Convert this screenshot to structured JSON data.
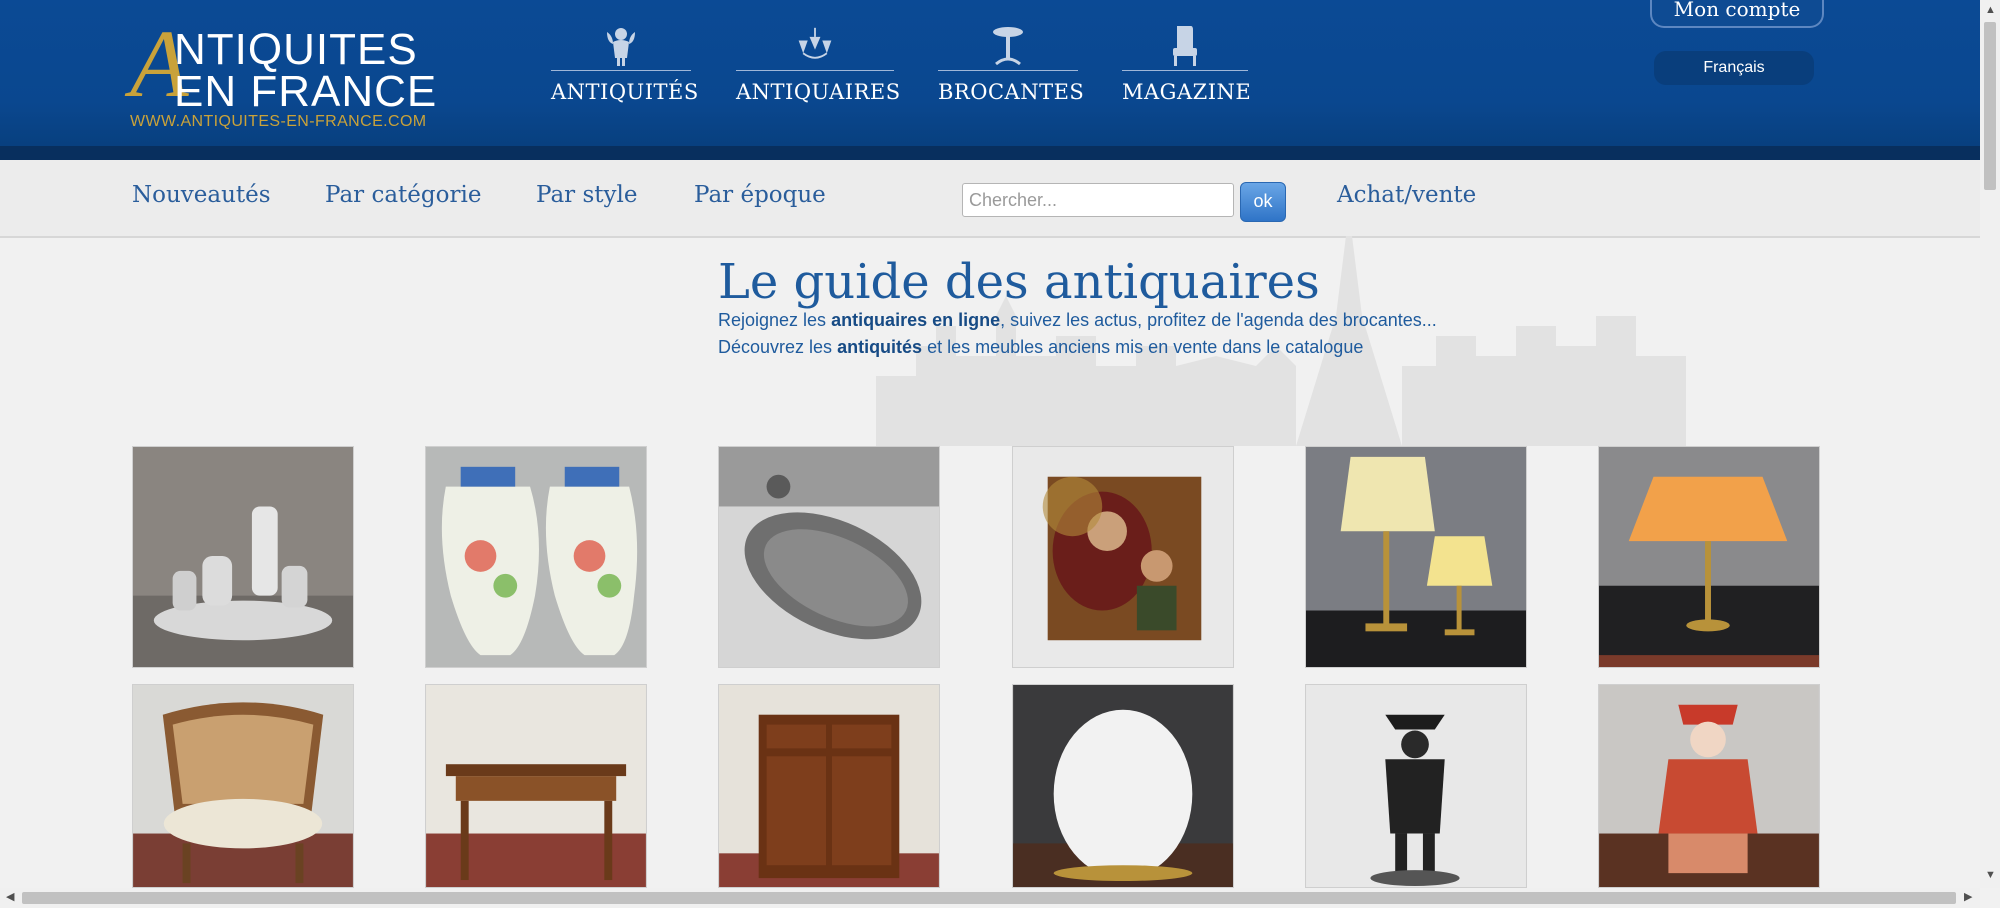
{
  "header": {
    "logo": {
      "big_letter": "A",
      "line1": "NTIQUITES",
      "line2": "EN FRANCE",
      "url": "WWW.ANTIQUITES-EN-FRANCE.COM"
    },
    "main_nav": [
      {
        "label": "ANTIQUITÉS",
        "icon": "cherub-icon"
      },
      {
        "label": "ANTIQUAIRES",
        "icon": "chandelier-icon"
      },
      {
        "label": "BROCANTES",
        "icon": "pedestal-table-icon"
      },
      {
        "label": "MAGAZINE",
        "icon": "armchair-icon"
      }
    ],
    "account_label": "Mon compte",
    "language": "Français"
  },
  "subnav": {
    "items": [
      "Nouveautés",
      "Par catégorie",
      "Par style",
      "Par époque"
    ],
    "search_placeholder": "Chercher...",
    "search_button": "ok",
    "buy_sell": "Achat/vente"
  },
  "hero": {
    "title": "Le guide des antiquaires",
    "line1_pre": "Rejoignez les ",
    "line1_bold": "antiquaires en ligne",
    "line1_post": ", suivez les actus, profitez de l'agenda des brocantes...",
    "line2_pre": "Découvrez les ",
    "line2_bold": "antiquités",
    "line2_post": " et les meubles anciens mis en vente dans le catalogue"
  },
  "products": [
    {
      "name": "silver-tea-set"
    },
    {
      "name": "pair-of-porcelain-vases"
    },
    {
      "name": "pewter-art-nouveau-dish"
    },
    {
      "name": "religious-icon-painting"
    },
    {
      "name": "pair-of-brass-lamps"
    },
    {
      "name": "brass-table-lamp"
    },
    {
      "name": "cane-armchair"
    },
    {
      "name": "writing-desk"
    },
    {
      "name": "wooden-cabinet"
    },
    {
      "name": "egg-glass-lamp"
    },
    {
      "name": "bronze-napoleon-statue"
    },
    {
      "name": "automaton-doll"
    }
  ],
  "colors": {
    "header_blue": "#0b4a95",
    "gold": "#c9a23a",
    "link_blue": "#2a5d9b"
  }
}
